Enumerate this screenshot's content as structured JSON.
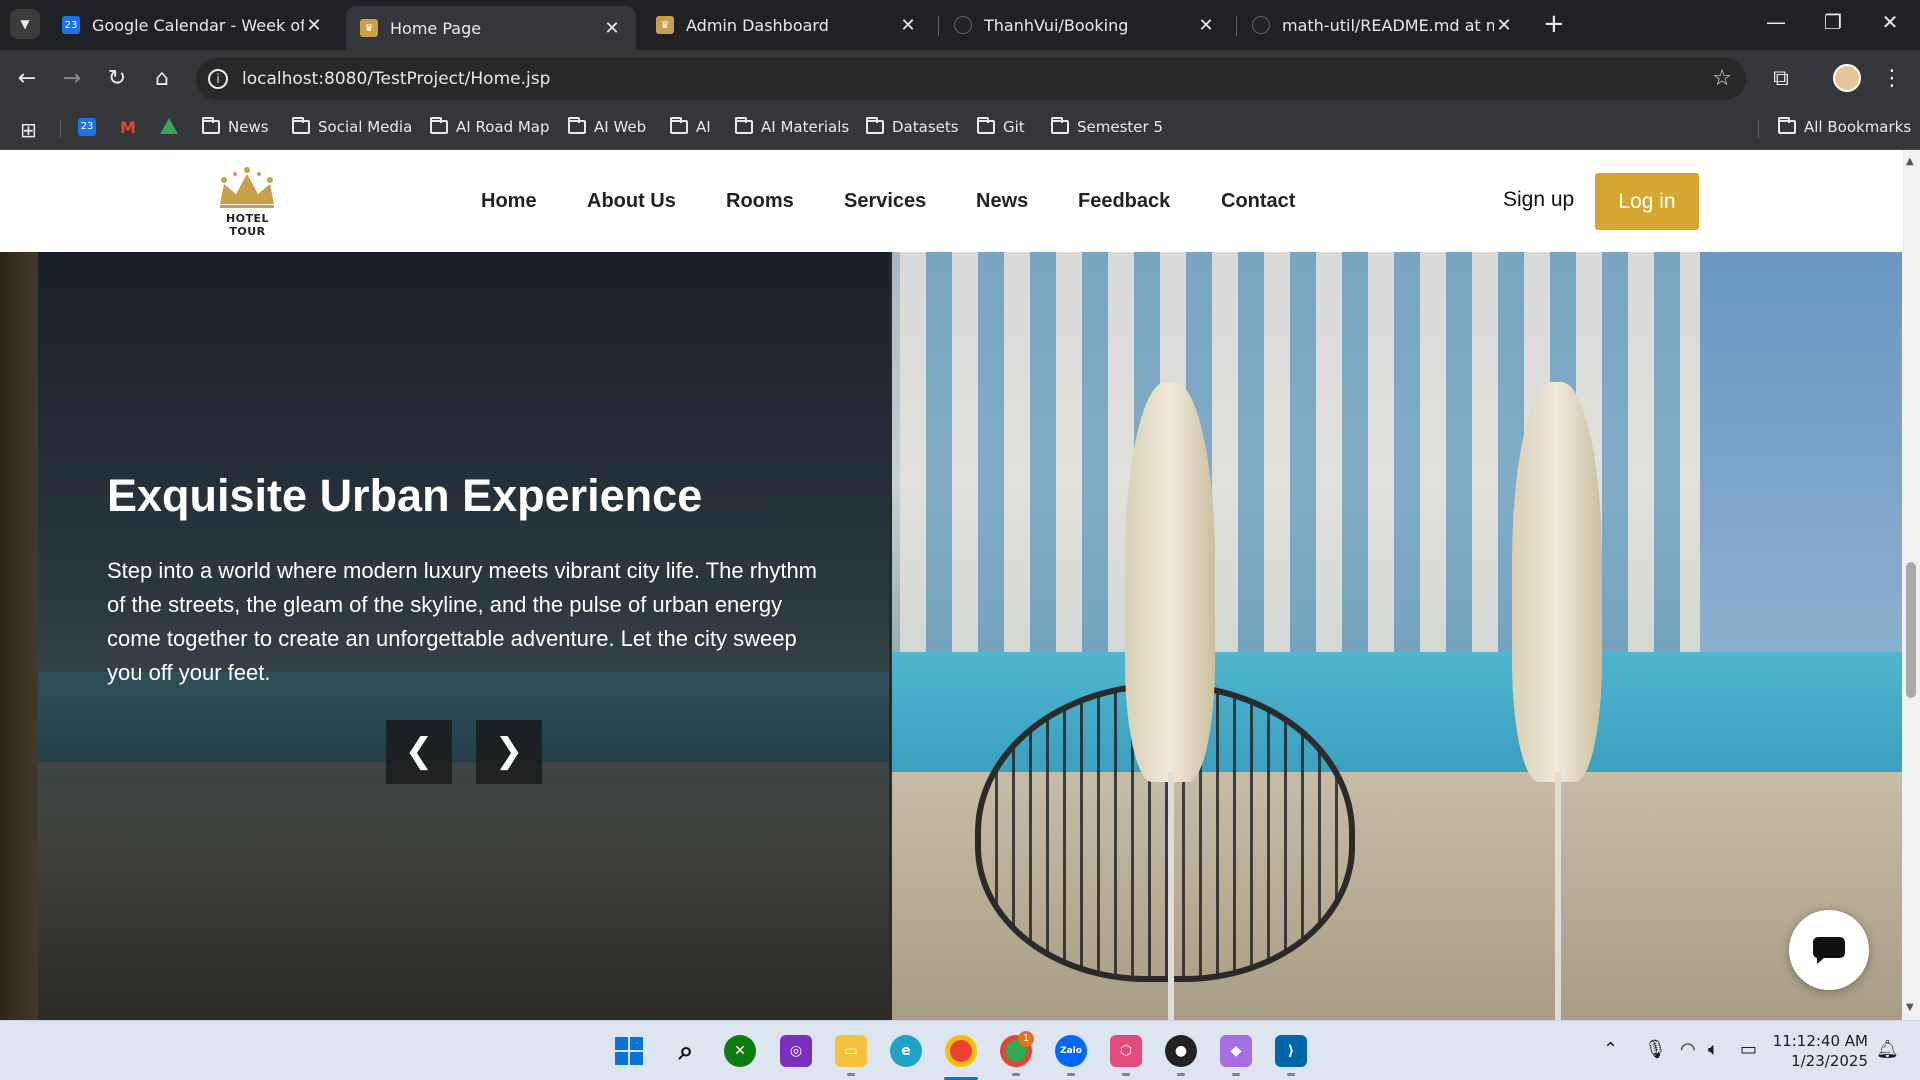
{
  "browser": {
    "tabs": [
      {
        "title": "Google Calendar - Week of Janu",
        "favicon": "calendar-icon",
        "active": false
      },
      {
        "title": "Home Page",
        "favicon": "hotel-logo-icon",
        "active": true
      },
      {
        "title": "Admin Dashboard",
        "favicon": "hotel-logo-icon",
        "active": false
      },
      {
        "title": "ThanhVui/Booking",
        "favicon": "github-icon",
        "active": false
      },
      {
        "title": "math-util/README.md at main",
        "favicon": "github-icon",
        "active": false
      }
    ],
    "url": "localhost:8080/TestProject/Home.jsp",
    "bookmarks": [
      {
        "label": "News"
      },
      {
        "label": "Social Media"
      },
      {
        "label": "AI Road Map"
      },
      {
        "label": "AI Web"
      },
      {
        "label": "AI"
      },
      {
        "label": "AI Materials"
      },
      {
        "label": "Datasets"
      },
      {
        "label": "Git"
      },
      {
        "label": "Semester 5"
      }
    ],
    "all_bookmarks": "All Bookmarks",
    "calendar_badge": "23"
  },
  "site": {
    "logo_text": "HOTEL TOUR",
    "nav": [
      "Home",
      "About Us",
      "Rooms",
      "Services",
      "News",
      "Feedback",
      "Contact"
    ],
    "signup": "Sign up",
    "login": "Log in",
    "accent_color": "#d4a830",
    "hero": {
      "title": "Exquisite Urban Experience",
      "text": "Step into a world where modern luxury meets vibrant city life. The rhythm of the streets, the gleam of the skyline, and the pulse of urban energy come together to create an unforgettable adventure. Let the city sweep you off your feet.",
      "prev": "❮",
      "next": "❯"
    }
  },
  "taskbar": {
    "time": "11:12:40 AM",
    "date": "1/23/2025",
    "chrome_badge": "1",
    "zalo_label": "Zalo"
  }
}
